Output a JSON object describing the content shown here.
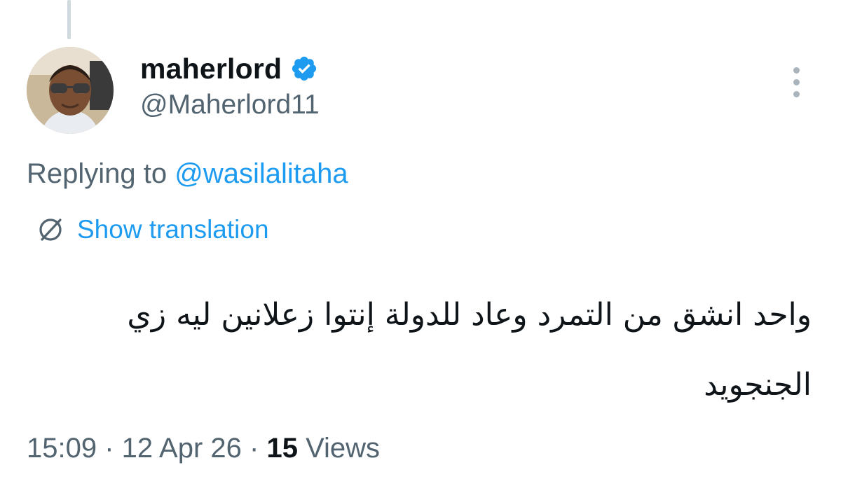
{
  "author": {
    "display_name": "maherlord",
    "handle": "@Maherlord11",
    "verified": true
  },
  "reply": {
    "prefix": "Replying to ",
    "to_handle": "@wasilalitaha"
  },
  "translation": {
    "label": "Show translation",
    "icon": "translate-icon"
  },
  "tweet": {
    "text": "واحد انشق من التمرد وعاد للدولة إنتوا زعلانين ليه زي الجنجويد"
  },
  "meta": {
    "time": "15:09",
    "sep1": " · ",
    "date": "12 Apr 26",
    "sep2": " · ",
    "views_count": "15",
    "views_label": " Views"
  },
  "colors": {
    "accent": "#1d9bf0",
    "secondary_text": "#536471",
    "primary_text": "#0f1419",
    "thread_line": "#cfd9de"
  }
}
